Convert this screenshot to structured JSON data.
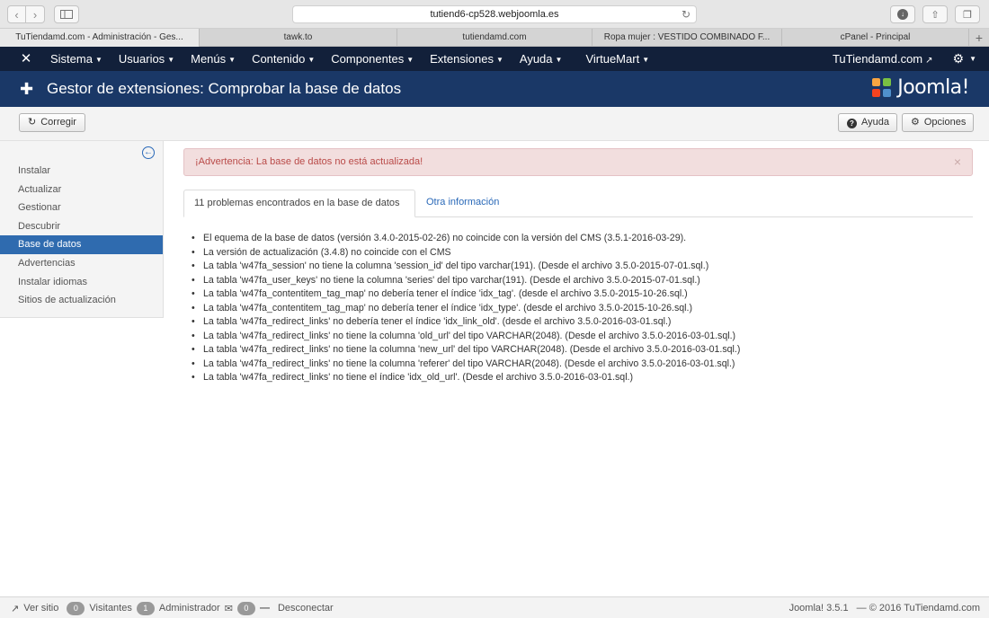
{
  "browser": {
    "url": "tutiend6-cp528.webjoomla.es",
    "tabs": [
      {
        "label": "TuTiendamd.com - Administración - Ges..."
      },
      {
        "label": "tawk.to"
      },
      {
        "label": "tutiendamd.com"
      },
      {
        "label": "Ropa mujer : VESTIDO COMBINADO F..."
      },
      {
        "label": "cPanel - Principal"
      }
    ]
  },
  "navbar": {
    "menu": [
      "Sistema",
      "Usuarios",
      "Menús",
      "Contenido",
      "Componentes",
      "Extensiones",
      "Ayuda",
      "VirtueMart"
    ],
    "site_link": "TuTiendamd.com"
  },
  "header": {
    "title": "Gestor de extensiones: Comprobar la base de datos",
    "logo_text": "Joomla!",
    "logo_colors": [
      "#f9a541",
      "#7ac143",
      "#f44321",
      "#5091cd"
    ]
  },
  "toolbar": {
    "fix_label": "Corregir",
    "help_label": "Ayuda",
    "options_label": "Opciones"
  },
  "sidebar": {
    "items": [
      "Instalar",
      "Actualizar",
      "Gestionar",
      "Descubrir",
      "Base de datos",
      "Advertencias",
      "Instalar idiomas",
      "Sitios de actualización"
    ],
    "active": "Base de datos"
  },
  "alert": {
    "text": "¡Advertencia: La base de datos no está actualizada!"
  },
  "tabs": {
    "problems_label": "11 problemas encontrados en la base de datos",
    "other_label": "Otra información"
  },
  "problems": [
    "El equema de la base de datos (versión 3.4.0-2015-02-26) no coincide con la versión del CMS (3.5.1-2016-03-29).",
    "La versión de actualización (3.4.8) no coincide con el CMS",
    "La tabla 'w47fa_session' no tiene la columna 'session_id' del tipo varchar(191). (Desde el archivo 3.5.0-2015-07-01.sql.)",
    "La tabla 'w47fa_user_keys' no tiene la columna 'series' del tipo varchar(191). (Desde el archivo 3.5.0-2015-07-01.sql.)",
    "La tabla 'w47fa_contentitem_tag_map' no debería tener el índice 'idx_tag'. (desde el archivo 3.5.0-2015-10-26.sql.)",
    "La tabla 'w47fa_contentitem_tag_map' no debería tener el índice 'idx_type'. (desde el archivo 3.5.0-2015-10-26.sql.)",
    "La tabla 'w47fa_redirect_links' no debería tener el índice 'idx_link_old'. (desde el archivo 3.5.0-2016-03-01.sql.)",
    "La tabla 'w47fa_redirect_links' no tiene la columna 'old_url' del tipo VARCHAR(2048). (Desde el archivo 3.5.0-2016-03-01.sql.)",
    "La tabla 'w47fa_redirect_links' no tiene la columna 'new_url' del tipo VARCHAR(2048). (Desde el archivo 3.5.0-2016-03-01.sql.)",
    "La tabla 'w47fa_redirect_links' no tiene la columna 'referer' del tipo VARCHAR(2048). (Desde el archivo 3.5.0-2016-03-01.sql.)",
    "La tabla 'w47fa_redirect_links' no tiene el índice 'idx_old_url'. (Desde el archivo 3.5.0-2016-03-01.sql.)"
  ],
  "statusbar": {
    "view_site": "Ver sitio",
    "visitors_count": "0",
    "visitors_label": "Visitantes",
    "admins_count": "1",
    "admins_label": "Administrador",
    "messages_count": "0",
    "logout": "Desconectar",
    "version": "Joomla! 3.5.1",
    "copyright": "© 2016 TuTiendamd.com"
  }
}
